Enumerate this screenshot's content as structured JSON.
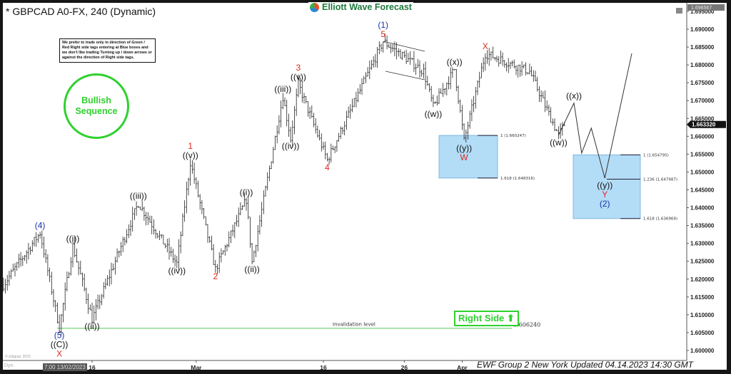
{
  "header": {
    "title": "* GBPCAD A0-FX, 240 (Dynamic)",
    "logo_text": "Elliott Wave Forecast"
  },
  "note": "We prefer to trade only in direction of Green / Red Right side tags entering at Blue boxes and we don't like trading Turning up / down arrows or against the direction of Right side tags.",
  "badge": {
    "text": "Bullish\nSequence",
    "color": "#2ed12e"
  },
  "right_side": {
    "text": "Right Side",
    "icon": "arrow-up-icon",
    "arrow": "⬆"
  },
  "invalidation": {
    "label": "Invalidation level",
    "value": "1.606240",
    "price": 1.60624,
    "color": "#8fd88f"
  },
  "axis_tags": {
    "top_price": "1.696567",
    "current_price": "1.663320"
  },
  "footer": {
    "updated": "EWF Group 2 New York Updated 04.14.2023 14:30 GMT",
    "crosshair_date": "7:00 13/02/2023",
    "dyn": "Dyn",
    "copyright": "© eSignal, 2023"
  },
  "chart_data": {
    "type": "ohlc",
    "symbol": "GBPCAD",
    "timeframe": "240",
    "ylim": [
      1.5975,
      1.697
    ],
    "grid": false,
    "y_ticks": [
      "1.600000",
      "1.605000",
      "1.610000",
      "1.615000",
      "1.620000",
      "1.625000",
      "1.630000",
      "1.635000",
      "1.640000",
      "1.645000",
      "1.650000",
      "1.655000",
      "1.660000",
      "1.665000",
      "1.670000",
      "1.675000",
      "1.680000",
      "1.685000",
      "1.690000",
      "1.695000"
    ],
    "x_ticks": [
      {
        "label": "16",
        "date": "2023-02-16"
      },
      {
        "label": "Mar",
        "date": "2023-03-01"
      },
      {
        "label": "16",
        "date": "2023-03-16"
      },
      {
        "label": "26",
        "date": "2023-03-26"
      },
      {
        "label": "Apr",
        "date": "2023-04-03"
      }
    ],
    "price_pivots": [
      {
        "t": "2023-02-06 08:00",
        "p": 1.6184
      },
      {
        "t": "2023-02-09 12:00",
        "p": 1.633
      },
      {
        "t": "2023-02-13 04:00",
        "p": 1.6063
      },
      {
        "t": "2023-02-14 08:00",
        "p": 1.6293
      },
      {
        "t": "2023-02-16 00:00",
        "p": 1.6088
      },
      {
        "t": "2023-02-22 00:00",
        "p": 1.6413
      },
      {
        "t": "2023-02-27 08:00",
        "p": 1.6243
      },
      {
        "t": "2023-02-28 12:00",
        "p": 1.6527
      },
      {
        "t": "2023-03-02 16:00",
        "p": 1.6227
      },
      {
        "t": "2023-03-07 08:00",
        "p": 1.6423
      },
      {
        "t": "2023-03-07 20:00",
        "p": 1.6247
      },
      {
        "t": "2023-03-10 12:00",
        "p": 1.6712
      },
      {
        "t": "2023-03-13 04:00",
        "p": 1.6593
      },
      {
        "t": "2023-03-13 20:00",
        "p": 1.6746
      },
      {
        "t": "2023-03-16 08:00",
        "p": 1.6533
      },
      {
        "t": "2023-03-23 04:00",
        "p": 1.6866
      },
      {
        "t": "2023-03-28 16:00",
        "p": 1.6782
      },
      {
        "t": "2023-03-29 12:00",
        "p": 1.6682
      },
      {
        "t": "2023-03-31 08:00",
        "p": 1.6788
      },
      {
        "t": "2023-04-03 04:00",
        "p": 1.6587
      },
      {
        "t": "2023-04-05 00:00",
        "p": 1.6832
      },
      {
        "t": "2023-04-10 20:00",
        "p": 1.6782
      },
      {
        "t": "2023-04-13 08:00",
        "p": 1.6603
      },
      {
        "t": "2023-04-13 20:00",
        "p": 1.66332
      }
    ],
    "projection": [
      {
        "t": "2023-04-13 08:00",
        "p": 1.6603
      },
      {
        "t": "2023-04-14 16:00",
        "p": 1.6693
      },
      {
        "t": "2023-04-17 08:00",
        "p": 1.6553
      },
      {
        "t": "2023-04-18 04:00",
        "p": 1.6623
      },
      {
        "t": "2023-04-19 08:00",
        "p": 1.6483
      },
      {
        "t": "2023-04-21 16:00",
        "p": 1.6832
      }
    ],
    "wave_labels": [
      {
        "src": "price",
        "i": 1,
        "pos": "above",
        "lines": [
          {
            "text": "(4)",
            "color": "#1a2fa8"
          }
        ]
      },
      {
        "src": "price",
        "i": 2,
        "pos": "below",
        "lines": [
          {
            "text": "(5)",
            "color": "#1a2fa8"
          },
          {
            "text": "((C))",
            "color": "#111111"
          },
          {
            "text": "X",
            "color": "#e0261f"
          }
        ]
      },
      {
        "src": "price",
        "i": 3,
        "pos": "above",
        "lines": [
          {
            "text": "((i))",
            "color": "#111111"
          }
        ]
      },
      {
        "src": "price",
        "i": 4,
        "pos": "below",
        "lines": [
          {
            "text": "((ii))",
            "color": "#111111"
          }
        ]
      },
      {
        "src": "price",
        "i": 5,
        "pos": "above",
        "lines": [
          {
            "text": "((iii))",
            "color": "#111111"
          }
        ]
      },
      {
        "src": "price",
        "i": 6,
        "pos": "below",
        "lines": [
          {
            "text": "((iv))",
            "color": "#111111"
          }
        ]
      },
      {
        "src": "price",
        "i": 7,
        "pos": "above",
        "lines": [
          {
            "text": "1",
            "color": "#e0261f"
          },
          {
            "text": "((v))",
            "color": "#111111"
          }
        ]
      },
      {
        "src": "price",
        "i": 8,
        "pos": "below",
        "lines": [
          {
            "text": "2",
            "color": "#e0261f"
          }
        ]
      },
      {
        "src": "price",
        "i": 9,
        "pos": "above",
        "lines": [
          {
            "text": "((i))",
            "color": "#111111"
          }
        ]
      },
      {
        "src": "price",
        "i": 10,
        "pos": "below",
        "lines": [
          {
            "text": "((ii))",
            "color": "#111111"
          }
        ]
      },
      {
        "src": "price",
        "i": 11,
        "pos": "above",
        "lines": [
          {
            "text": "((iii))",
            "color": "#111111"
          }
        ]
      },
      {
        "src": "price",
        "i": 12,
        "pos": "below",
        "lines": [
          {
            "text": "((iv))",
            "color": "#111111"
          }
        ]
      },
      {
        "src": "price",
        "i": 13,
        "pos": "above",
        "lines": [
          {
            "text": "3",
            "color": "#e0261f"
          },
          {
            "text": "((v))",
            "color": "#111111"
          }
        ]
      },
      {
        "src": "price",
        "i": 14,
        "pos": "below",
        "lines": [
          {
            "text": "4",
            "color": "#e0261f"
          }
        ]
      },
      {
        "src": "price",
        "i": 15,
        "pos": "above",
        "lines": [
          {
            "text": "(1)",
            "color": "#1a2fa8"
          },
          {
            "text": "5",
            "color": "#e0261f"
          }
        ]
      },
      {
        "src": "price",
        "i": 17,
        "pos": "below",
        "lines": [
          {
            "text": "((w))",
            "color": "#111111"
          }
        ]
      },
      {
        "src": "price",
        "i": 18,
        "pos": "above",
        "lines": [
          {
            "text": "((x))",
            "color": "#111111"
          }
        ]
      },
      {
        "src": "price",
        "i": 19,
        "pos": "below",
        "lines": [
          {
            "text": "((y))",
            "color": "#111111"
          },
          {
            "text": "W",
            "color": "#e0261f"
          }
        ]
      },
      {
        "src": "price",
        "i": 20,
        "pos": "above",
        "lines": [
          {
            "text": "X",
            "color": "#e0261f"
          }
        ]
      },
      {
        "src": "price",
        "i": 22,
        "pos": "below",
        "lines": [
          {
            "text": "((w))",
            "color": "#111111"
          }
        ]
      },
      {
        "src": "projection",
        "i": 1,
        "pos": "above",
        "lines": [
          {
            "text": "((x))",
            "color": "#111111"
          }
        ]
      },
      {
        "src": "projection",
        "i": 4,
        "pos": "below",
        "lines": [
          {
            "text": "((y))",
            "color": "#111111"
          },
          {
            "text": "Y",
            "color": "#e0261f"
          },
          {
            "text": "(2)",
            "color": "#1a2fa8"
          }
        ]
      }
    ],
    "blue_boxes": [
      {
        "color": "#b3dcf7",
        "levels": [
          {
            "label": "1 (1.660247)",
            "price": 1.660247
          },
          {
            "label": "1.618 (1.648316)",
            "price": 1.648316
          }
        ]
      },
      {
        "color": "#b3dcf7",
        "levels": [
          {
            "label": "1 (1.654795)",
            "price": 1.654795
          },
          {
            "label": "1.236 (1.647987)",
            "price": 1.647987
          },
          {
            "label": "1.618 (1.636969)",
            "price": 1.636969
          }
        ]
      }
    ]
  }
}
